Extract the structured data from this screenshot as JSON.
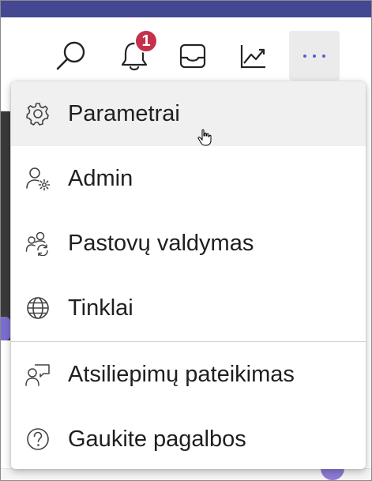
{
  "toolbar": {
    "notifications_count": "1",
    "icons": [
      "search-icon",
      "bell-icon",
      "inbox-icon",
      "chart-icon",
      "more-icon"
    ]
  },
  "menu": {
    "items": [
      {
        "label": "Parametrai",
        "icon": "gear-icon"
      },
      {
        "label": "Admin",
        "icon": "admin-person-gear-icon"
      },
      {
        "label": "Pastovų valdymas",
        "icon": "people-sync-icon"
      },
      {
        "label": "Tinklai",
        "icon": "globe-icon"
      },
      {
        "label": "Atsiliepimų pateikimas",
        "icon": "feedback-person-icon"
      },
      {
        "label": "Gaukite pagalbos",
        "icon": "help-icon"
      }
    ]
  },
  "colors": {
    "top_strip": "#444791",
    "badge": "#c4314b",
    "menu_hover": "#f0f0f0",
    "more_button_bg": "#ebebeb"
  }
}
